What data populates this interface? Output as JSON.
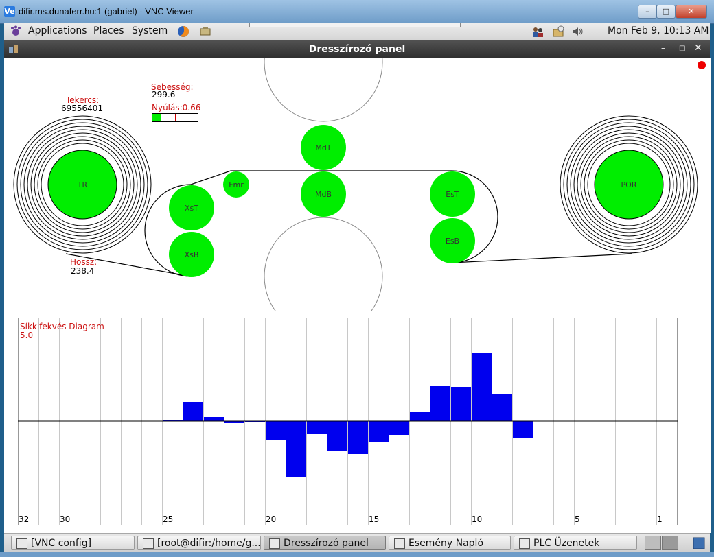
{
  "window": {
    "title": "difir.ms.dunaferr.hu:1 (gabriel) - VNC Viewer",
    "logo": "Ve"
  },
  "gnome_panel": {
    "menus": [
      "Applications",
      "Places",
      "System"
    ],
    "clock": "Mon Feb  9, 10:13 AM"
  },
  "app": {
    "title": "Dresszírozó panel"
  },
  "panel": {
    "tekercs_label": "Tekercs:",
    "tekercs_value": "69556401",
    "sebesseg_label": "Sebesség:",
    "sebesseg_value": "299.6",
    "nyulas_label": "Nyúlás:0.66",
    "nyulas_fill": 0.2,
    "hossz_label": "Hossz:",
    "hossz_value": "238.4",
    "rolls": {
      "tr": "TR",
      "por": "POR",
      "mdt": "MdT",
      "mdb": "MdB",
      "fmr": "Fmr",
      "xst": "XsT",
      "xsb": "XsB",
      "est": "EsT",
      "esb": "EsB"
    },
    "colors": {
      "roll": "#00ee00",
      "bar": "#0000ee",
      "label": "#cc1111",
      "alarm": "#ee0000"
    }
  },
  "chart_data": {
    "type": "bar",
    "title": "Síkkifekvés Diagram",
    "scale_label": "5.0",
    "ylim": [
      -5,
      5
    ],
    "x_tick_labels": [
      "32",
      "30",
      "25",
      "20",
      "15",
      "10",
      "5",
      "1"
    ],
    "categories": [
      32,
      31,
      30,
      29,
      28,
      27,
      26,
      25,
      24,
      23,
      22,
      21,
      20,
      19,
      18,
      17,
      16,
      15,
      14,
      13,
      12,
      11,
      10,
      9,
      8,
      7,
      6,
      5,
      4,
      3,
      2,
      1
    ],
    "values": [
      0,
      0,
      0,
      0,
      0,
      0,
      0,
      0.05,
      1.4,
      0.3,
      -0.1,
      -0.05,
      -1.4,
      -4.1,
      -0.9,
      -2.2,
      -2.4,
      -1.5,
      -1.0,
      0.7,
      2.6,
      2.5,
      4.95,
      1.95,
      -1.2,
      0,
      0,
      0,
      0,
      0,
      0,
      0
    ],
    "grid": true
  },
  "taskbar": {
    "items": [
      "[VNC config]",
      "[root@difir:/home/g...",
      "Dresszírozó panel",
      "Esemény Napló",
      "PLC Üzenetek"
    ],
    "active_index": 2
  }
}
